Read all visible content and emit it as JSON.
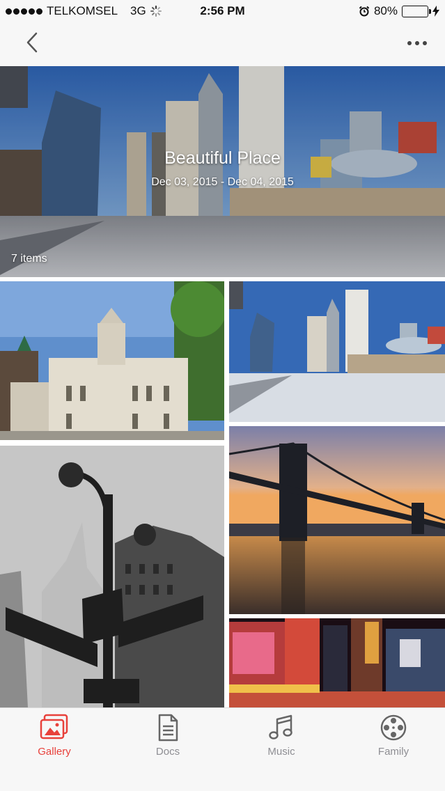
{
  "status_bar": {
    "carrier": "TELKOMSEL",
    "network": "3G",
    "time": "2:56 PM",
    "battery": "80%",
    "battery_level": 0.8
  },
  "nav": {
    "back_icon": "chevron-left-icon",
    "more_icon": "ellipsis-icon"
  },
  "album": {
    "title": "Beautiful Place",
    "dates": "Dec 03, 2015 - Dec 04, 2015",
    "count": "7 items"
  },
  "tabs": [
    {
      "label": "Gallery",
      "icon": "gallery-icon",
      "active": true
    },
    {
      "label": "Docs",
      "icon": "document-icon",
      "active": false
    },
    {
      "label": "Music",
      "icon": "music-note-icon",
      "active": false
    },
    {
      "label": "Family",
      "icon": "film-reel-icon",
      "active": false
    }
  ],
  "colors": {
    "accent": "#e8413b",
    "tab_inactive": "#8e8e93",
    "bar_background": "#f7f7f7",
    "battery_green": "#4cd964"
  }
}
